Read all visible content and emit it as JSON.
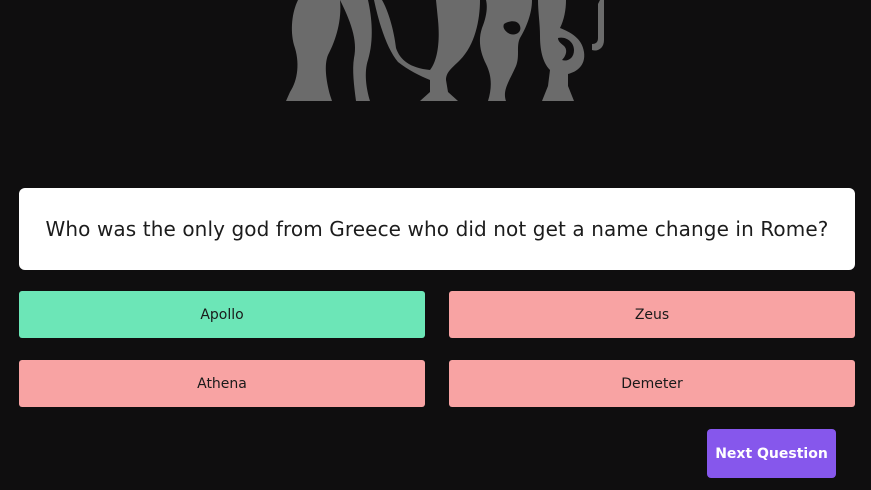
{
  "hero": {
    "icon": "greek-amphorae-silhouette-icon",
    "color": "#6b6b6b"
  },
  "quiz": {
    "question": "Who was the only god from Greece who did not get a name change in Rome?",
    "answers": [
      {
        "label": "Apollo",
        "status": "correct"
      },
      {
        "label": "Zeus",
        "status": "wrong"
      },
      {
        "label": "Athena",
        "status": "wrong"
      },
      {
        "label": "Demeter",
        "status": "wrong"
      }
    ],
    "next_label": "Next Question"
  },
  "colors": {
    "background": "#0f0e0f",
    "correct": "#6ce6b7",
    "wrong": "#f8a3a3",
    "accent": "#8657ec"
  }
}
